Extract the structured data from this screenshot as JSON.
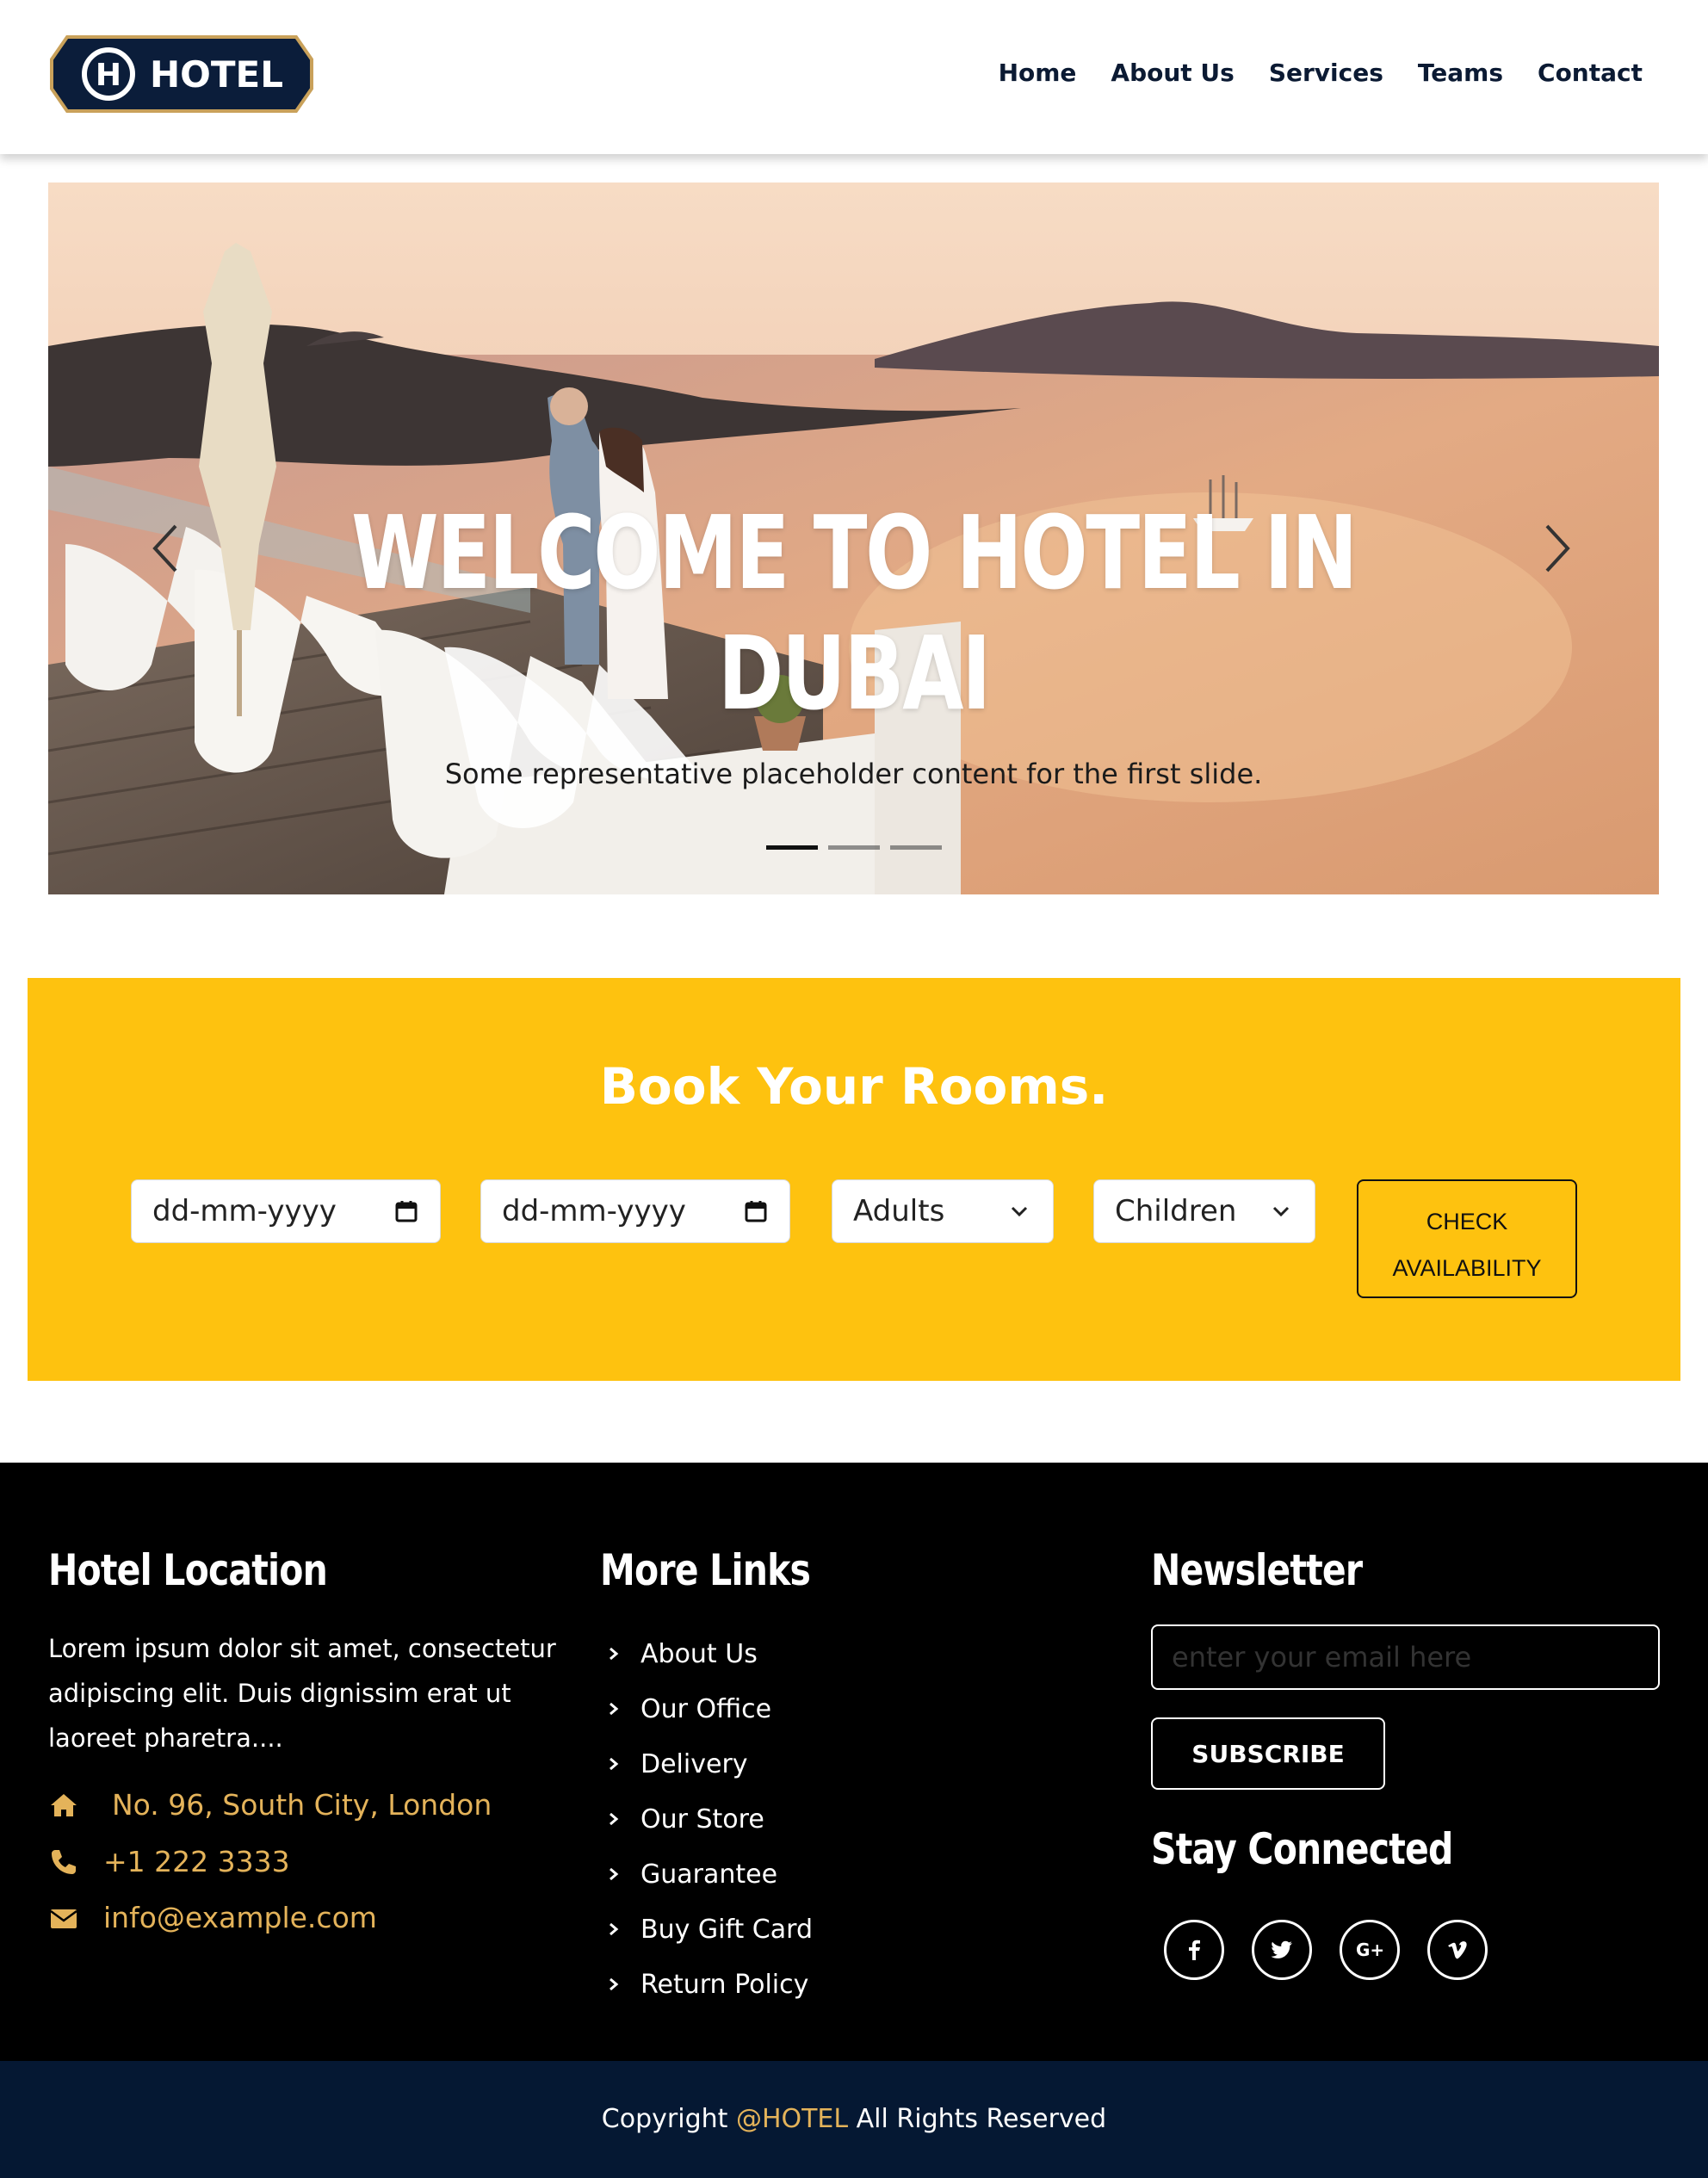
{
  "brand": {
    "logo_text": "HOTEL",
    "logo_letter": "H"
  },
  "nav": {
    "items": [
      {
        "label": "Home"
      },
      {
        "label": "About Us"
      },
      {
        "label": "Services"
      },
      {
        "label": "Teams"
      },
      {
        "label": "Contact"
      }
    ]
  },
  "hero": {
    "title": "WELCOME TO HOTEL IN DUBAI",
    "caption": "Some representative placeholder content for the first slide.",
    "slide_count": 3,
    "active_slide": 1
  },
  "booking": {
    "title": "Book Your Rooms.",
    "checkin_placeholder": "dd-mm-yyyy",
    "checkout_placeholder": "dd-mm-yyyy",
    "adults_label": "Adults",
    "children_label": "Children",
    "check_button_line1": "CHECK",
    "check_button_line2": "AVAILABILITY"
  },
  "footer": {
    "location": {
      "title": "Hotel Location",
      "text": "Lorem ipsum dolor sit amet, consectetur adipiscing elit. Duis dignissim erat ut laoreet pharetra....",
      "address": "No. 96, South City, London",
      "phone": "+1 222 3333",
      "email": "info@example.com"
    },
    "links": {
      "title": "More Links",
      "items": [
        "About Us",
        "Our Office",
        "Delivery",
        "Our Store",
        "Guarantee",
        "Buy Gift Card",
        "Return Policy"
      ]
    },
    "newsletter": {
      "title": "Newsletter",
      "placeholder": "enter your email here",
      "button": "SUBSCRIBE",
      "social_title": "Stay Connected",
      "socials": [
        "facebook-icon",
        "twitter-icon",
        "google-plus-icon",
        "vimeo-icon"
      ]
    }
  },
  "copyright": {
    "prefix": "Copyright",
    "brand": "@HOTEL",
    "suffix": "All Rights Reserved"
  },
  "colors": {
    "accent": "#fec20f",
    "navy": "#051833",
    "gold": "#e4b35a"
  }
}
